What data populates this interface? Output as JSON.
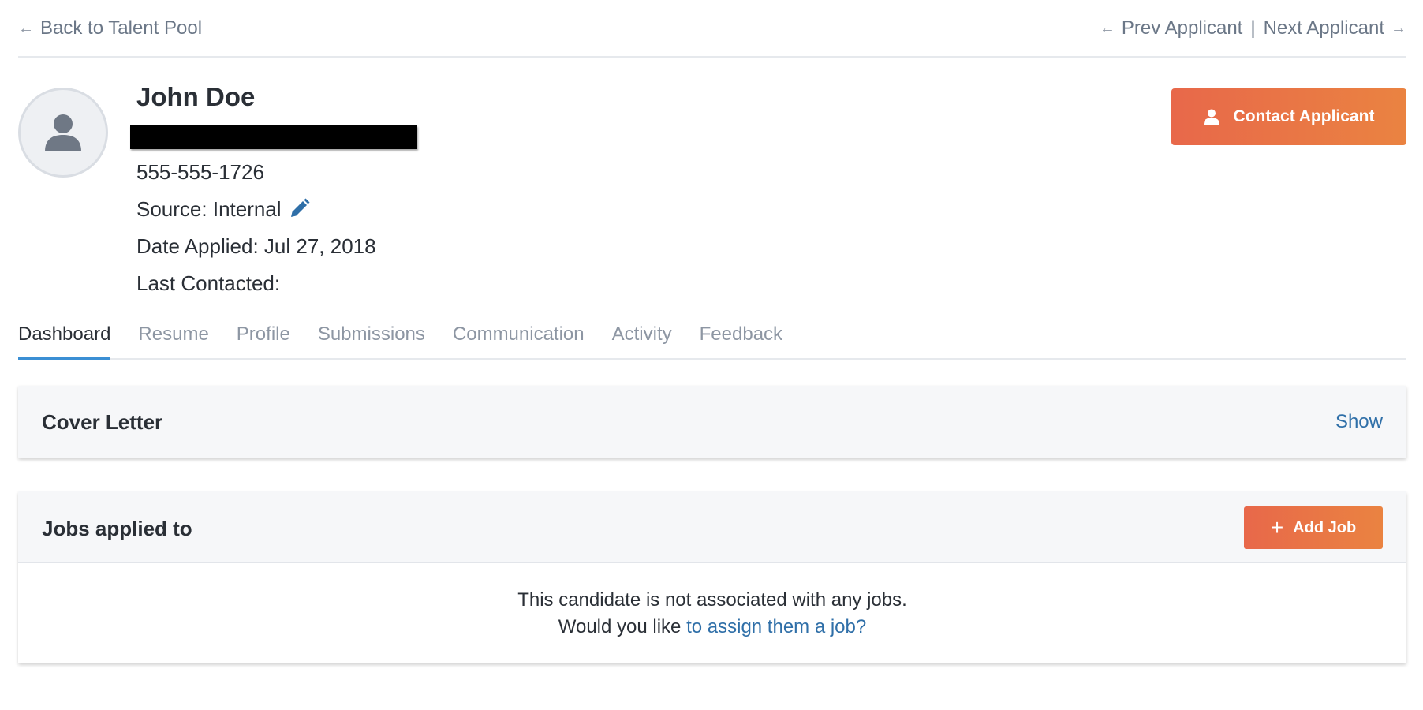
{
  "nav": {
    "back_label": "Back to Talent Pool",
    "prev_label": "Prev Applicant",
    "separator": "|",
    "next_label": "Next Applicant"
  },
  "applicant": {
    "name": "John Doe",
    "phone": "555-555-1726",
    "source_label": "Source:",
    "source_value": "Internal",
    "date_applied_label": "Date Applied:",
    "date_applied_value": "Jul 27, 2018",
    "last_contacted_label": "Last Contacted:",
    "last_contacted_value": ""
  },
  "actions": {
    "contact_label": "Contact Applicant"
  },
  "tabs": [
    {
      "label": "Dashboard",
      "active": true
    },
    {
      "label": "Resume",
      "active": false
    },
    {
      "label": "Profile",
      "active": false
    },
    {
      "label": "Submissions",
      "active": false
    },
    {
      "label": "Communication",
      "active": false
    },
    {
      "label": "Activity",
      "active": false
    },
    {
      "label": "Feedback",
      "active": false
    }
  ],
  "cover_letter": {
    "title": "Cover Letter",
    "toggle_label": "Show"
  },
  "jobs": {
    "title": "Jobs applied to",
    "add_label": "Add Job",
    "empty_message": "This candidate is not associated with any jobs.",
    "prompt_prefix": "Would you like",
    "prompt_link": "to assign them a job?"
  },
  "colors": {
    "accent_orange": "#e8684a",
    "link_blue": "#2f6fa8",
    "tab_underline": "#3b8fd4"
  },
  "icons": {
    "back": "arrow-left-icon",
    "prev": "arrow-left-icon",
    "next": "arrow-right-icon",
    "avatar": "user-silhouette-icon",
    "edit": "pencil-icon",
    "contact": "user-icon",
    "add": "plus-icon"
  }
}
